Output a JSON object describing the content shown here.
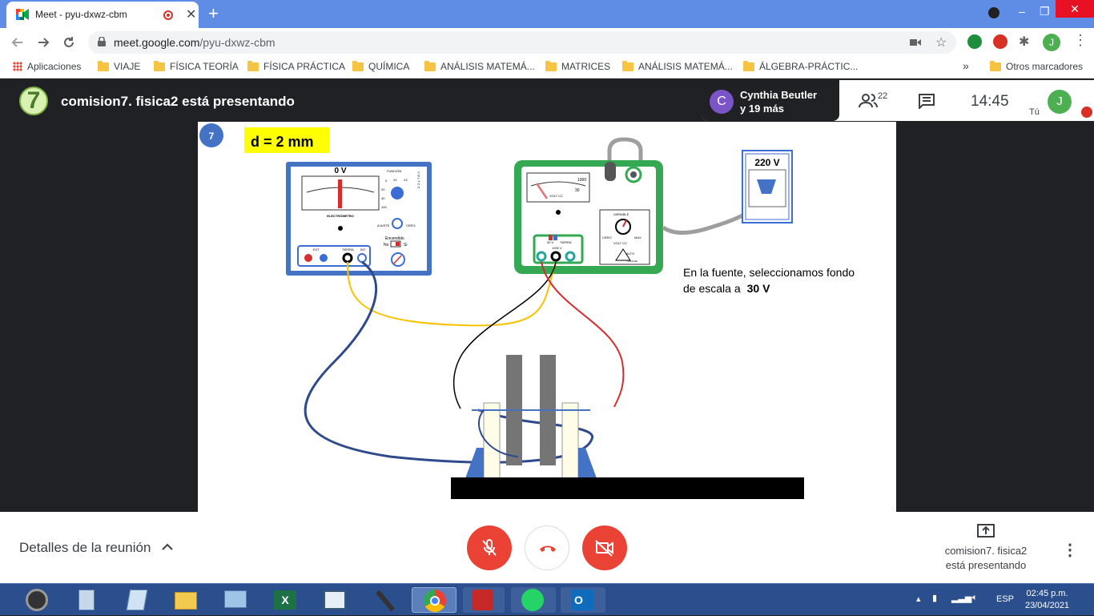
{
  "browser": {
    "tab_title": "Meet - pyu-dxwz-cbm",
    "tab_close": "✕",
    "new_tab": "+",
    "url_domain": "meet.google.com",
    "url_path": "/pyu-dxwz-cbm",
    "window_controls": {
      "minimize": "–",
      "restore": "❐",
      "close": "✕"
    }
  },
  "bookmarks": {
    "apps": "Aplicaciones",
    "items": [
      "VIAJE",
      "FÍSICA TEORÍA",
      "FÍSICA PRÁCTICA",
      "QUÍMICA",
      "ANÁLISIS MATEMÁ...",
      "MATRICES",
      "ANÁLISIS MATEMÁ...",
      "ÁLGEBRA-PRÁCTIC..."
    ],
    "overflow": "»",
    "other": "Otros marcadores"
  },
  "meet": {
    "presenter_initial": "7",
    "presenter_title": "comision7. fisica2 está presentando",
    "participant_initial": "C",
    "participant_name": "Cynthia Beutler",
    "participant_more": "y 19 más",
    "people_count": "22",
    "clock": "14:45",
    "you_label": "Tú",
    "self_initial": "J",
    "details_label": "Detalles de la reunión",
    "presenting_line1": "comision7. fisica2",
    "presenting_line2": "está presentando",
    "colors": {
      "red": "#ea4335",
      "green": "#4caf50",
      "purple": "#7b54c7"
    }
  },
  "slide": {
    "badge": "7",
    "distance_label": "d = 2 mm",
    "electrometer": {
      "reading": "0 V",
      "brand": "ELECTRÓMETRO",
      "function_label": "FUNCIÓN",
      "side_label": "V O L T  C C",
      "ajuste": "AJUSTE",
      "cero": "CERO",
      "encendido": "Encendido",
      "no": "No",
      "si": "Si",
      "terminals": [
        "EXT",
        "TIERRA",
        "INT"
      ],
      "scale_marks": [
        "0",
        "X1",
        "X2",
        "20",
        "40",
        "100"
      ]
    },
    "source": {
      "scale_max": "1000",
      "scale_30": "30",
      "volt_cc": "VOLT CC",
      "variable": "VARIABLE",
      "cero": "CERO",
      "max": "MAX",
      "volt_cc2": "VOLT CC",
      "alto": "ALTO",
      "voltaje": "VOLTAJE",
      "terminal_labels": [
        "30 V",
        "TIERRA",
        "1000 V"
      ]
    },
    "outlet_label": "220 V",
    "note_line1": "En la fuente, seleccionamos fondo",
    "note_line2": "de escala a",
    "note_value": "30 V"
  },
  "taskbar": {
    "language": "ESP",
    "time": "02:45 p.m.",
    "date": "23/04/2021",
    "apps": [
      "camera",
      "calculator",
      "notepad",
      "explorer",
      "control-panel",
      "excel",
      "publisher",
      "microphone",
      "chrome",
      "acrobat",
      "whatsapp",
      "outlook"
    ]
  }
}
